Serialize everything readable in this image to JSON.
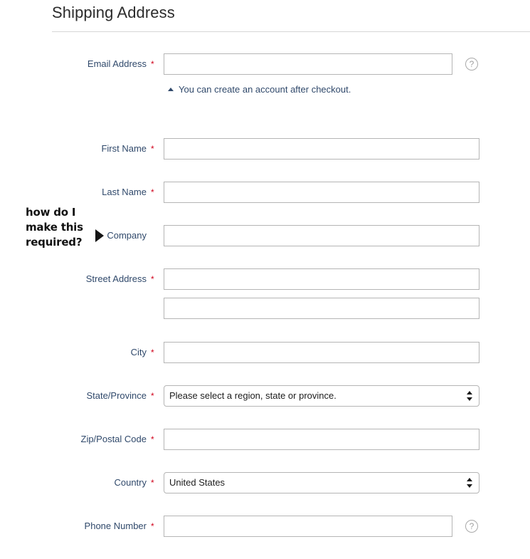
{
  "header": {
    "title": "Shipping Address"
  },
  "annotation": {
    "text": "how do I make this required?",
    "pointer_icon": "triangle-right-icon"
  },
  "hint": {
    "icon": "triangle-up-icon",
    "text": "You can create an account after checkout."
  },
  "icons": {
    "help": "?",
    "help_name": "help-circle-icon"
  },
  "required_marker": "*",
  "colors": {
    "label": "#30496b",
    "required": "#d0021b",
    "border": "#b5b5b5",
    "rule": "#d6d6d6",
    "title": "#2b2b2b",
    "annotation": "#111111"
  },
  "fields": {
    "email": {
      "label": "Email Address",
      "value": "",
      "placeholder": "",
      "required": true
    },
    "first_name": {
      "label": "First Name",
      "value": "",
      "placeholder": "",
      "required": true
    },
    "last_name": {
      "label": "Last Name",
      "value": "",
      "placeholder": "",
      "required": true
    },
    "company": {
      "label": "Company",
      "value": "",
      "placeholder": "",
      "required": false
    },
    "street1": {
      "label": "Street Address",
      "value": "",
      "placeholder": "",
      "required": true
    },
    "street2": {
      "label": "",
      "value": "",
      "placeholder": "",
      "required": false
    },
    "city": {
      "label": "City",
      "value": "",
      "placeholder": "",
      "required": true
    },
    "state": {
      "label": "State/Province",
      "value": "Please select a region, state or province.",
      "required": true
    },
    "zip": {
      "label": "Zip/Postal Code",
      "value": "",
      "placeholder": "",
      "required": true
    },
    "country": {
      "label": "Country",
      "value": "United States",
      "required": true
    },
    "phone": {
      "label": "Phone Number",
      "value": "",
      "placeholder": "",
      "required": true
    }
  }
}
